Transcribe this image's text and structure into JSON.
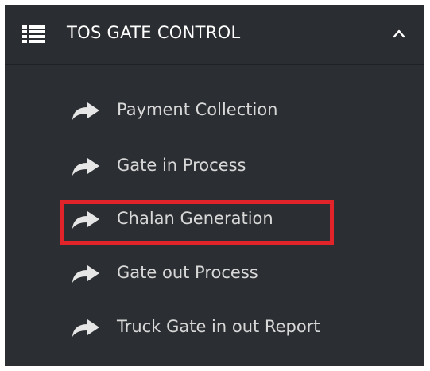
{
  "section": {
    "title": "TOS GATE CONTROL",
    "list_icon": "list-icon",
    "collapse_icon": "chevron-up-icon"
  },
  "menu": {
    "items": [
      {
        "label": "Payment Collection",
        "icon": "share-arrow-icon"
      },
      {
        "label": "Gate in Process",
        "icon": "share-arrow-icon"
      },
      {
        "label": "Chalan Generation",
        "icon": "share-arrow-icon",
        "highlighted": true
      },
      {
        "label": "Gate out Process",
        "icon": "share-arrow-icon"
      },
      {
        "label": "Truck Gate in out Report",
        "icon": "share-arrow-icon"
      }
    ]
  },
  "colors": {
    "panel_bg": "#2b2e32",
    "text": "#d8d8d8",
    "title": "#ffffff",
    "highlight": "#e0242a"
  }
}
